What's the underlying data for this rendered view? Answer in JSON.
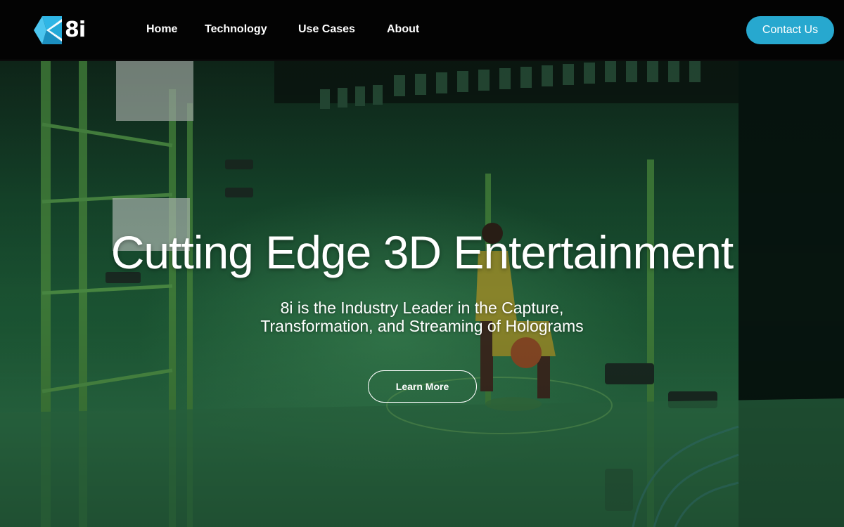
{
  "header": {
    "logo_text": "8i",
    "nav": [
      {
        "label": "Home"
      },
      {
        "label": "Technology"
      },
      {
        "label": "Use Cases"
      },
      {
        "label": "About"
      }
    ],
    "contact_label": "Contact Us"
  },
  "hero": {
    "title": "Cutting Edge 3D Entertainment",
    "subtitle_line1": "8i is the Industry Leader in the Capture,",
    "subtitle_line2": "Transformation, and Streaming of Holograms",
    "cta_label": "Learn More"
  },
  "colors": {
    "header_bg": "#030303",
    "accent": "#27a8cf",
    "logo_blue": "#23a9d8",
    "hero_green": "#1d5a36"
  },
  "icons": {
    "logo": "8i-logo-mark"
  }
}
